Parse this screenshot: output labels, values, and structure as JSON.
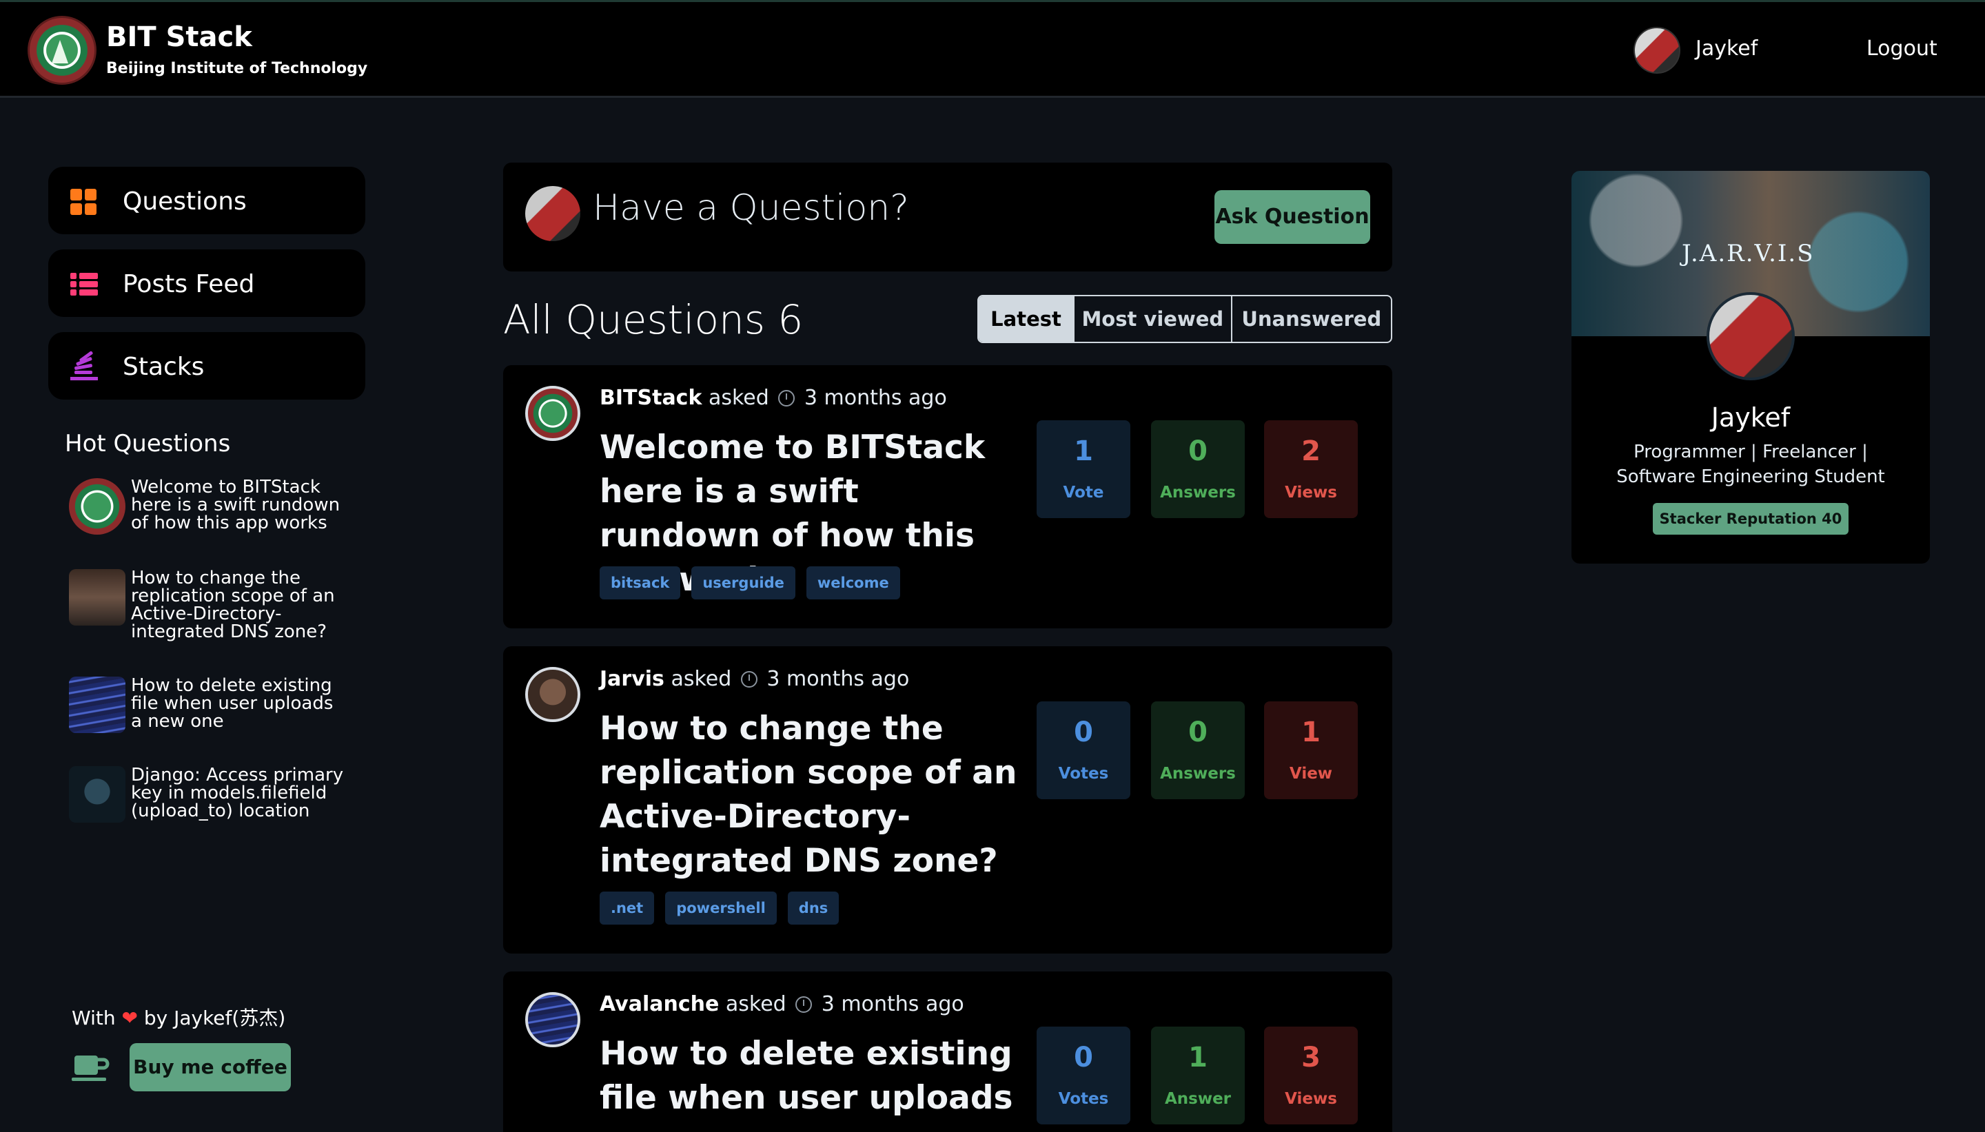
{
  "brand": {
    "title": "BIT Stack",
    "subtitle": "Beijing Institute of Technology"
  },
  "nav": {
    "username": "Jaykef",
    "logout": "Logout"
  },
  "sidebar": {
    "items": [
      {
        "label": "Questions",
        "icon": "grid-icon"
      },
      {
        "label": "Posts Feed",
        "icon": "list-icon"
      },
      {
        "label": "Stacks",
        "icon": "stack-icon"
      }
    ],
    "hot_title": "Hot Questions",
    "hot": [
      {
        "text": "Welcome to BITStack here is a swift rundown of how this app works"
      },
      {
        "text": "How to change the replication scope of an Active-Directory-integrated DNS zone?"
      },
      {
        "text": "How to delete existing file when user uploads a new one"
      },
      {
        "text": "Django: Access primary key in models.filefield (upload_to) location"
      }
    ],
    "footer": {
      "with": "With",
      "by": "by Jaykef(苏杰)",
      "coffee": "Buy me coffee"
    }
  },
  "ask": {
    "prompt": "Have a Question?",
    "button": "Ask Question"
  },
  "questions_header": {
    "title": "All Questions 6",
    "filters": [
      "Latest",
      "Most viewed",
      "Unanswered"
    ],
    "active_filter": "Latest"
  },
  "questions": [
    {
      "author": "BITStack",
      "asked": "asked",
      "time": "3 months ago",
      "title": "Welcome to BITStack here is a swift rundown of how this app works",
      "tags": [
        "bitsack",
        "userguide",
        "welcome"
      ],
      "votes": "1",
      "votes_label": "Vote",
      "answers": "0",
      "answers_label": "Answers",
      "views": "2",
      "views_label": "Views"
    },
    {
      "author": "Jarvis",
      "asked": "asked",
      "time": "3 months ago",
      "title": "How to change the replication scope of an Active-Directory-integrated DNS zone?",
      "tags": [
        ".net",
        "powershell",
        "dns"
      ],
      "votes": "0",
      "votes_label": "Votes",
      "answers": "0",
      "answers_label": "Answers",
      "views": "1",
      "views_label": "View"
    },
    {
      "author": "Avalanche",
      "asked": "asked",
      "time": "3 months ago",
      "title": "How to delete existing file when user uploads a new one",
      "tags": [],
      "votes": "0",
      "votes_label": "Votes",
      "answers": "1",
      "answers_label": "Answer",
      "views": "3",
      "views_label": "Views"
    }
  ],
  "profile": {
    "banner_text": "J.A.R.V.I.S",
    "name": "Jaykef",
    "bio": "Programmer | Freelancer | Software Engineering Student",
    "reputation": "Stacker Reputation 40"
  },
  "colors": {
    "accent_green": "#5fa382",
    "vote_blue": "#4c8fdf",
    "answer_green": "#4fae5a",
    "view_red": "#e2564c",
    "background": "#0d1117"
  }
}
